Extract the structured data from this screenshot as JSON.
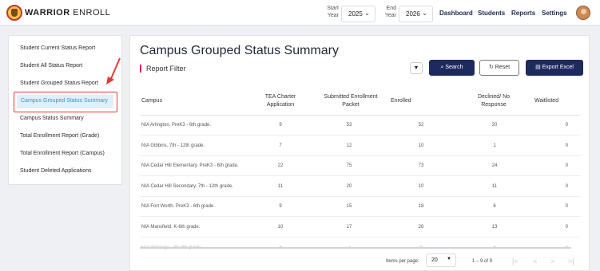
{
  "header": {
    "brand_bold": "WARRIOR",
    "brand_rest": " ENROLL",
    "start_year_label_1": "Start",
    "start_year_label_2": "Year",
    "start_year_value": "2025",
    "end_year_label_1": "End",
    "end_year_label_2": "Year",
    "end_year_value": "2026",
    "nav": [
      "Dashboard",
      "Students",
      "Reports",
      "Settings"
    ]
  },
  "sidebar": {
    "items": [
      "Student Current Status Report",
      "Student All Status Report",
      "Student Grouped Status Report",
      "Campus Grouped Status Summary",
      "Campus Status Summary",
      "Total Enrollment Report (Grade)",
      "Total Enrollment Report (Campus)",
      "Student Deleted Applications"
    ],
    "active_index": 3
  },
  "main": {
    "title": "Campus Grouped Status Summary",
    "filter_label": "Report Filter",
    "buttons": {
      "search": "Search",
      "reset": "Reset",
      "export": "Export Excel"
    },
    "columns": [
      "Campus",
      "TEA Charter Application",
      "Submitted Enrollment Packet",
      "Enrolled",
      "Declined/ No Response",
      "Waitlisted"
    ],
    "rows": [
      [
        "NIA Arlington. PreK3 - 6th grade.",
        "9",
        "53",
        "52",
        "20",
        "0"
      ],
      [
        "NIA Gibbins. 7th - 12th grade.",
        "7",
        "12",
        "10",
        "1",
        "0"
      ],
      [
        "NIA Cedar Hill Elementary. PreK3 - 6th grade.",
        "22",
        "75",
        "73",
        "24",
        "0"
      ],
      [
        "NIA Cedar Hill Secondary. 7th - 12th grade.",
        "11",
        "20",
        "10",
        "11",
        "0"
      ],
      [
        "NIA Fort Worth. PreK3 - 6th grade.",
        "9",
        "15",
        "18",
        "6",
        "0"
      ],
      [
        "NIA Mansfield. K-6th grade.",
        "10",
        "17",
        "26",
        "13",
        "0"
      ],
      [
        "NIA Watauga. 7th-9th grade.",
        "8",
        "7",
        "9",
        "8",
        "0"
      ]
    ],
    "pagination": {
      "items_per_page_label": "Items per page:",
      "items_per_page_value": "20",
      "range": "1 – 9 of 9"
    }
  },
  "colors": {
    "primary": "#1c2a5e",
    "active_bg": "#dff0fb",
    "active_text": "#3a8fd0",
    "annotation": "#e53935",
    "filter_accent": "#e91e63"
  }
}
